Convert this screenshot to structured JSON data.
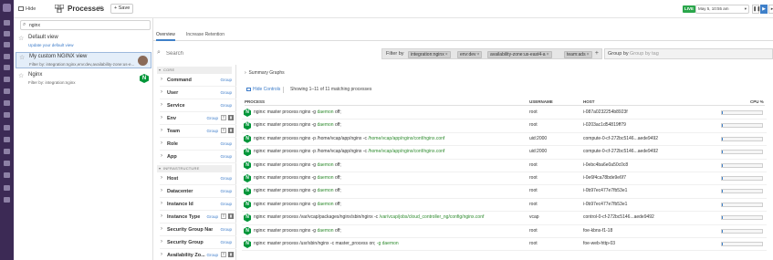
{
  "topbar": {
    "hide_label": "Hide",
    "title": "Processes",
    "save_label": "Save",
    "live_label": "LIVE",
    "time_range": "May 5, 10:55 am",
    "play_icon": "pause-icon",
    "accent_color": "#3f80c9"
  },
  "views": {
    "search_value": "nginx",
    "items": [
      {
        "name": "Default view",
        "sub": "Update your default view",
        "sub_link": true,
        "selected": false
      },
      {
        "name": "My custom NGINX view",
        "sub": "Filter by: integration:nginx,env:dev,availability-zone:us-e...",
        "selected": true
      },
      {
        "name": "Nginx",
        "sub": "Filter by: integration:nginx",
        "badge": "N",
        "selected": false
      }
    ]
  },
  "tabs": [
    {
      "label": "Overview",
      "active": true
    },
    {
      "label": "Increase Retention",
      "active": false
    }
  ],
  "search": {
    "placeholder": "Search",
    "filter_label": "Filter by",
    "filters": [
      "integration:nginx",
      "env:dev",
      "availability-zone:us-east4-a",
      "team:ads"
    ],
    "groupby_label": "Group by",
    "groupby_placeholder": "Group by tag"
  },
  "facets": {
    "core_label": "CORE",
    "infra_label": "INFRASTRUCTURE",
    "group_label": "Group",
    "core": [
      {
        "name": "Command",
        "toggles": false
      },
      {
        "name": "User",
        "toggles": false
      },
      {
        "name": "Service",
        "toggles": false
      },
      {
        "name": "Env",
        "toggles": true
      },
      {
        "name": "Team",
        "toggles": true
      },
      {
        "name": "Role",
        "toggles": false
      },
      {
        "name": "App",
        "toggles": false
      }
    ],
    "infra": [
      {
        "name": "Host",
        "toggles": false
      },
      {
        "name": "Datacenter",
        "toggles": false
      },
      {
        "name": "Instance Id",
        "toggles": false
      },
      {
        "name": "Instance Type",
        "toggles": true
      },
      {
        "name": "Security Group Name",
        "toggles": false
      },
      {
        "name": "Security Group",
        "toggles": false
      },
      {
        "name": "Availability Zo...",
        "toggles": true
      }
    ]
  },
  "processes": {
    "summary_label": "Summary Graphs",
    "hide_controls_label": "Hide Controls",
    "showing": "Showing 1–11 of 11 matching processes",
    "columns": [
      "PROCESS",
      "USERNAME",
      "HOST",
      "CPU %"
    ],
    "rows": [
      {
        "cmd": "nginx: master process nginx -g",
        "arg": "daemon",
        "tail": "off;",
        "user": "root",
        "host": "i-087a0232254b8923f",
        "cpu": 0.02
      },
      {
        "cmd": "nginx: master process nginx -g",
        "arg": "daemon",
        "tail": "off;",
        "user": "root",
        "host": "i-0203ac1d54819ff79",
        "cpu": 0.02
      },
      {
        "cmd": "nginx: master process nginx -p /home/vcap/app/nginx -c",
        "arg": "/home/vcap/app/nginx/conf/nginx.conf",
        "tail": "",
        "user": "uid:2000",
        "host": "compute-0-cf-272bc5146...aede9492",
        "cpu": 0.02
      },
      {
        "cmd": "nginx: master process nginx -p /home/vcap/app/nginx -c",
        "arg": "/home/vcap/app/nginx/conf/nginx.conf",
        "tail": "",
        "user": "uid:2000",
        "host": "compute-0-cf-272bc5146...aede9492",
        "cpu": 0.02
      },
      {
        "cmd": "nginx: master process nginx -g",
        "arg": "daemon",
        "tail": "off;",
        "user": "root",
        "host": "i-0ebc4ba6e0a50c0c8",
        "cpu": 0.02
      },
      {
        "cmd": "nginx: master process nginx -g",
        "arg": "daemon",
        "tail": "off;",
        "user": "root",
        "host": "i-0e6f4ca78bde9e6f7",
        "cpu": 0.02
      },
      {
        "cmd": "nginx: master process nginx -g",
        "arg": "daemon",
        "tail": "off;",
        "user": "root",
        "host": "i-0b97ec477e7fb53e1",
        "cpu": 0.02
      },
      {
        "cmd": "nginx: master process nginx -g",
        "arg": "daemon",
        "tail": "off;",
        "user": "root",
        "host": "i-0b97ec477e7fb53e1",
        "cpu": 0.02
      },
      {
        "cmd": "nginx: master process /var/vcap/packages/nginx/sbin/nginx -c",
        "arg": "/var/vcap/jobs/cloud_controller_ng/config/nginx.conf",
        "tail": "",
        "user": "vcap",
        "host": "control-0-cf-272bc5146...aede9492",
        "cpu": 0.02
      },
      {
        "cmd": "nginx: master process nginx -g",
        "arg": "daemon",
        "tail": "off;",
        "user": "root",
        "host": "foe-kbns-f1-18",
        "cpu": 0.02
      },
      {
        "cmd": "nginx: master process /usr/sbin/nginx -c master_process on;",
        "arg": "-g daemon",
        "tail": "",
        "user": "root",
        "host": "foe-web-http-03",
        "cpu": 0.02
      }
    ]
  }
}
